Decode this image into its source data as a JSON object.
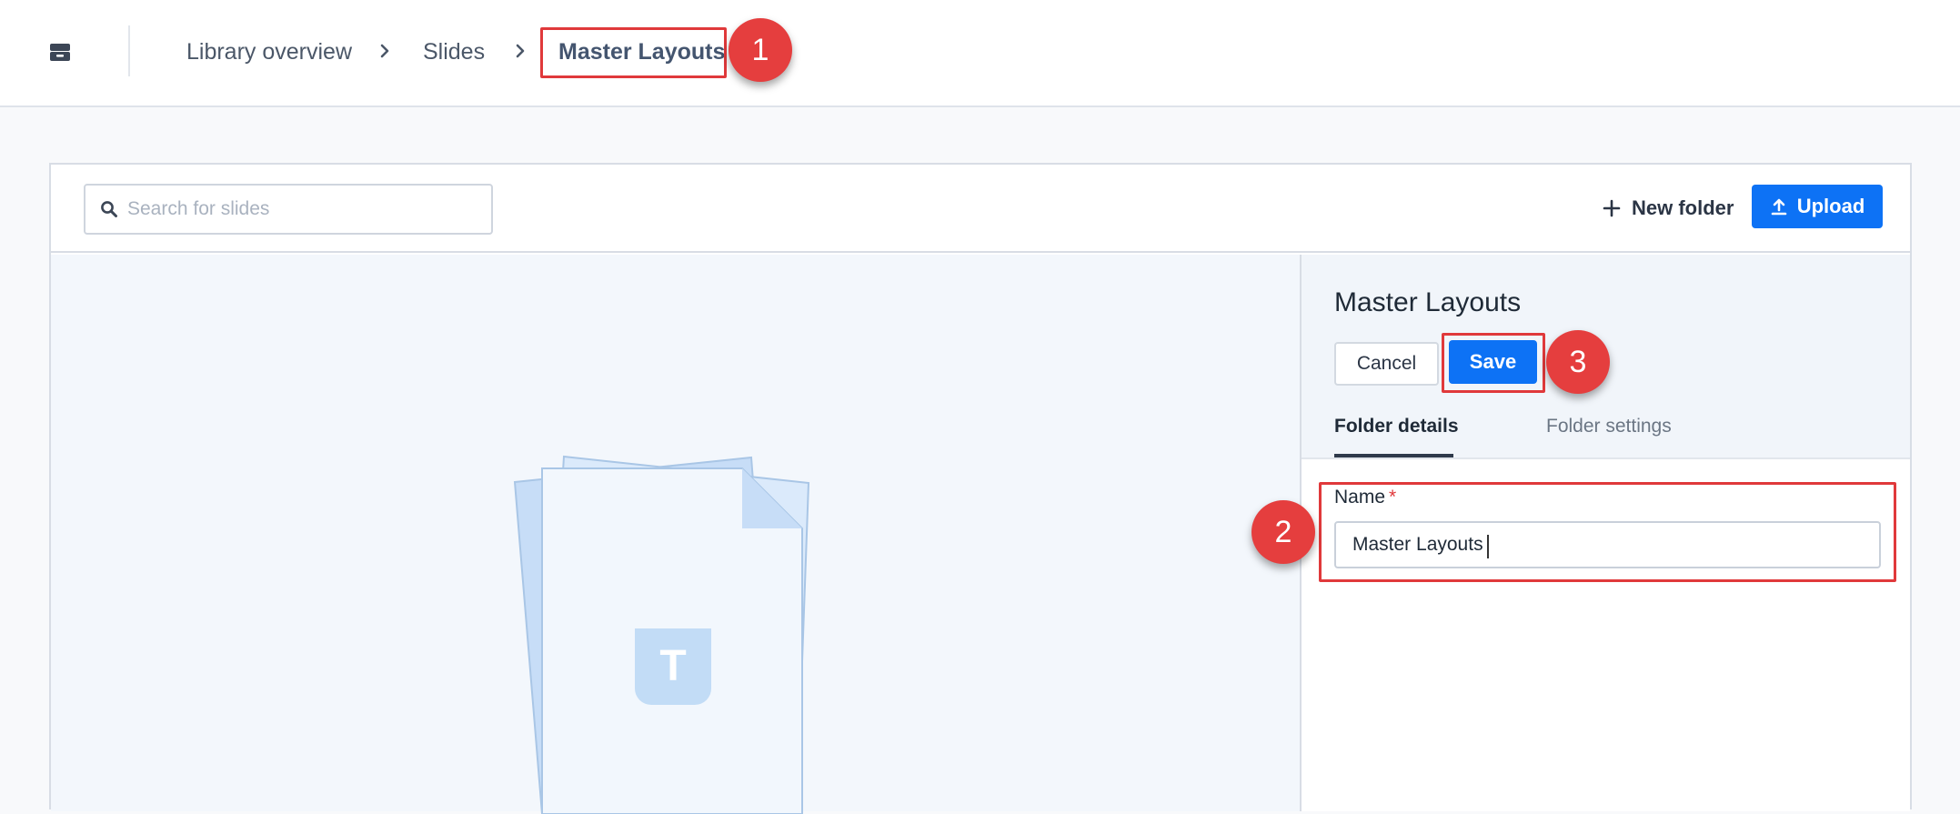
{
  "breadcrumb": {
    "items": [
      "Library overview",
      "Slides",
      "Master Layouts"
    ]
  },
  "toolbar": {
    "search_placeholder": "Search for slides",
    "new_folder_label": "New folder",
    "upload_label": "Upload"
  },
  "panel": {
    "title": "Master Layouts",
    "cancel_label": "Cancel",
    "save_label": "Save",
    "tabs": [
      {
        "label": "Folder details",
        "active": true
      },
      {
        "label": "Folder settings",
        "active": false
      }
    ],
    "name_field": {
      "label": "Name",
      "required_mark": "*",
      "value": "Master Layouts"
    }
  },
  "illustration": {
    "badge_letter": "T"
  },
  "callouts": [
    "1",
    "2",
    "3"
  ],
  "colors": {
    "primary": "#0d72f5",
    "highlight": "#e0393b",
    "callout": "#e53e3e"
  },
  "icons": {
    "archive": "archive-icon",
    "chevron": "chevron-right-icon",
    "search": "search-icon",
    "plus": "plus-icon",
    "upload": "upload-icon"
  }
}
